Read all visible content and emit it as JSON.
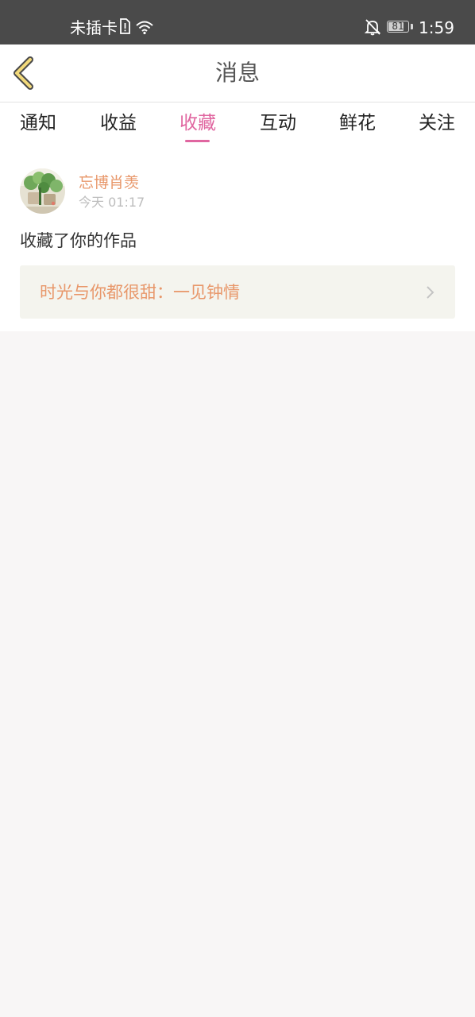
{
  "status_bar": {
    "carrier": "未插卡",
    "battery": "81",
    "battery_level": 0.81,
    "time": "1:59"
  },
  "header": {
    "title": "消息",
    "back_icon": "chevron-left-icon"
  },
  "tabs": [
    {
      "label": "通知",
      "active": false
    },
    {
      "label": "收益",
      "active": false
    },
    {
      "label": "收藏",
      "active": true
    },
    {
      "label": "互动",
      "active": false
    },
    {
      "label": "鲜花",
      "active": false
    },
    {
      "label": "关注",
      "active": false
    }
  ],
  "message": {
    "username": "忘博肖羡",
    "timestamp": "今天 01:17",
    "action": "收藏了你的作品",
    "work_title": "时光与你都很甜：一见钟情"
  },
  "colors": {
    "accent": "#e066a0",
    "username": "#e8976a",
    "statusbar": "#4a4a4a",
    "page_bg": "#f8f6f6"
  }
}
